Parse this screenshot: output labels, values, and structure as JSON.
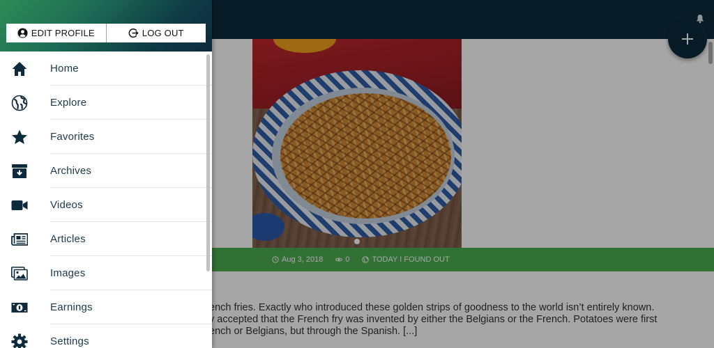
{
  "drawer": {
    "edit_profile_label": "EDIT PROFILE",
    "log_out_label": "LOG OUT",
    "items": [
      {
        "label": "Home",
        "icon": "home-icon"
      },
      {
        "label": "Explore",
        "icon": "globe-icon"
      },
      {
        "label": "Favorites",
        "icon": "star-icon"
      },
      {
        "label": "Archives",
        "icon": "archive-icon"
      },
      {
        "label": "Videos",
        "icon": "video-camera-icon"
      },
      {
        "label": "Articles",
        "icon": "newspaper-icon"
      },
      {
        "label": "Images",
        "icon": "images-icon"
      },
      {
        "label": "Earnings",
        "icon": "money-icon"
      },
      {
        "label": "Settings",
        "icon": "gear-icon"
      }
    ]
  },
  "post": {
    "date": "Aug 3, 2018",
    "views": "0",
    "source": "TODAY I FOUND OUT",
    "excerpt_lines": [
      "ench fries. Exactly who introduced these golden strips of goodness to the world isn’t entirely known.",
      "y accepted that the French fry was invented by either the Belgians or the French. Potatoes were first",
      "ench or Belgians, but through the Spanish.  [...]"
    ]
  },
  "colors": {
    "topbar": "#0d2b3d",
    "accent_green": "#4caf50",
    "menu_text": "#1b3a4b"
  }
}
